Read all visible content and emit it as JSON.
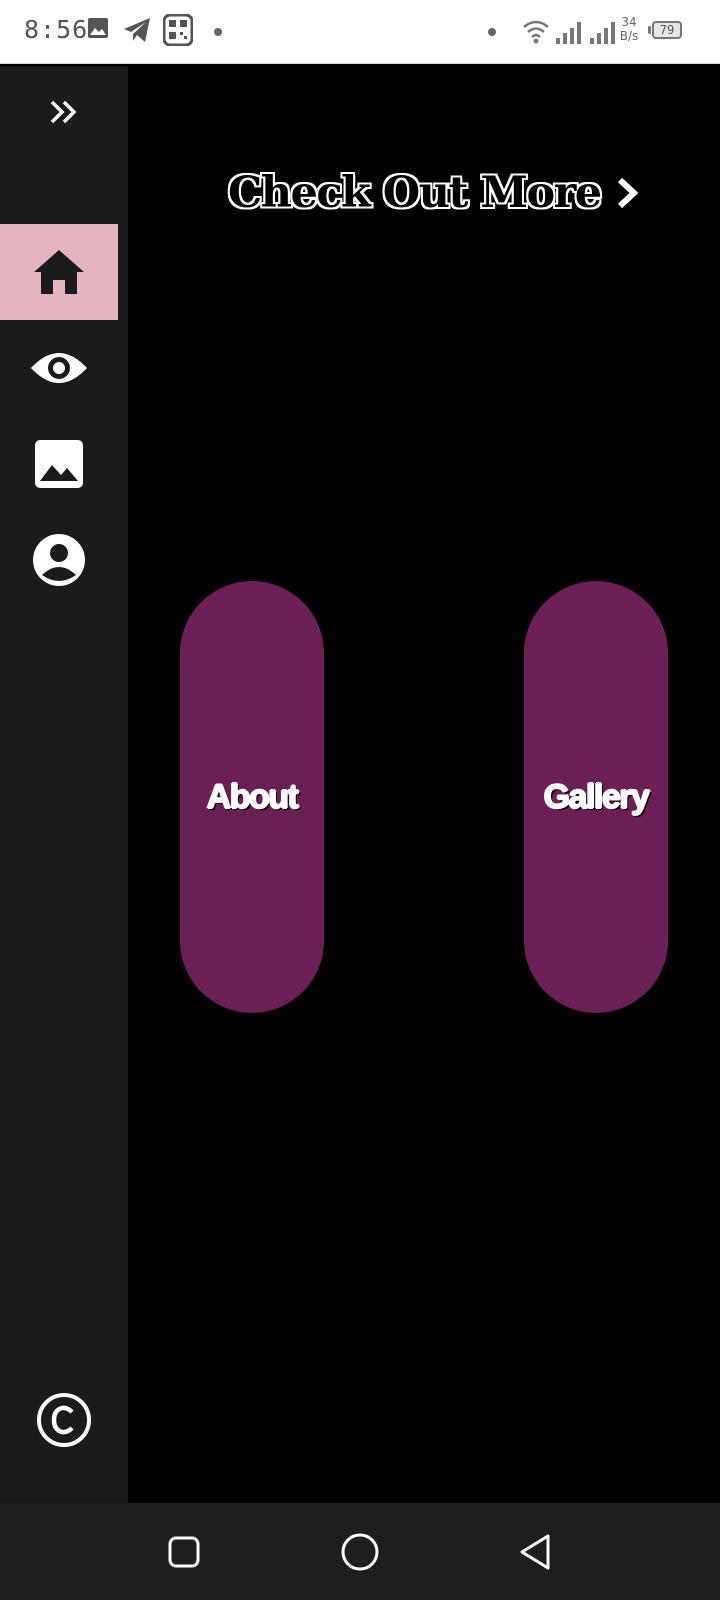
{
  "status_bar": {
    "time": "8:56",
    "net_speed_value": "34",
    "net_speed_unit": "B/s",
    "battery_level": "79",
    "icons": [
      "image-notification-icon",
      "telegram-icon",
      "qr-scanner-icon",
      "notification-dot-icon",
      "wifi-icon",
      "signal-icon",
      "signal-icon",
      "battery-icon"
    ]
  },
  "sidebar": {
    "expand_icon": "double-chevron-right-icon",
    "items": [
      {
        "name": "home",
        "icon": "home-icon",
        "active": true
      },
      {
        "name": "views",
        "icon": "eye-icon",
        "active": false
      },
      {
        "name": "gallery",
        "icon": "image-icon",
        "active": false
      },
      {
        "name": "profile",
        "icon": "account-circle-icon",
        "active": false
      }
    ],
    "footer_icon": "copyright-icon"
  },
  "main": {
    "headline": "Check Out More",
    "headline_icon": "chevron-right-icon",
    "buttons": [
      {
        "label": "About"
      },
      {
        "label": "Gallery"
      }
    ]
  },
  "nav_bar": {
    "icons": [
      "recents-square-icon",
      "home-circle-icon",
      "back-triangle-icon"
    ]
  },
  "colors": {
    "background": "#000000",
    "sidebar": "#1b1b1d",
    "active_item": "#e4b4bf",
    "pill": "#6b1f55",
    "nav_bar": "#1e1e1e"
  }
}
